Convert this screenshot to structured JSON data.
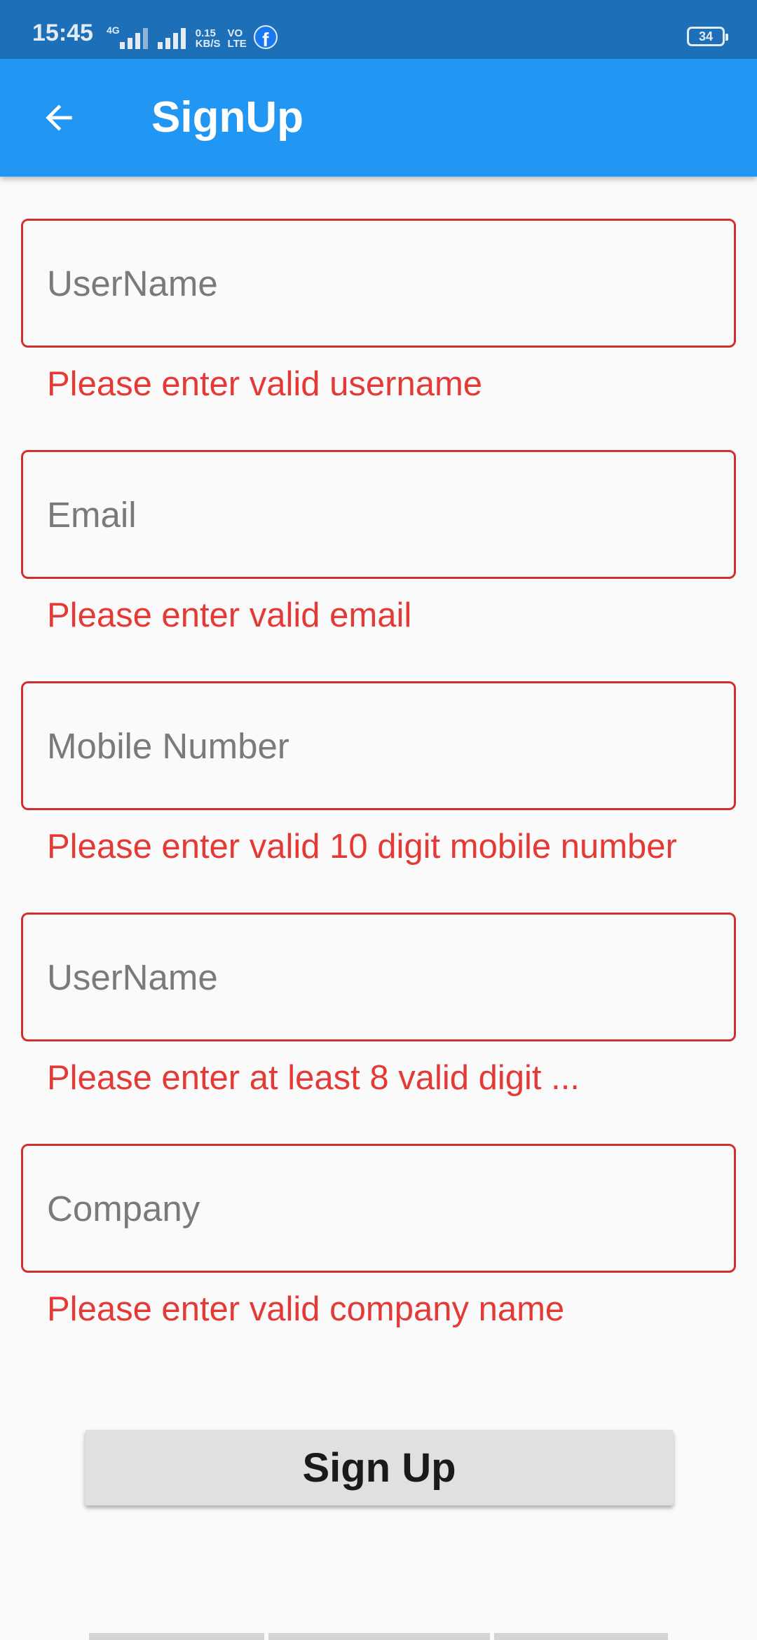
{
  "status_bar": {
    "time": "15:45",
    "network_label": "4G",
    "speed_value": "0.15",
    "speed_unit": "KB/S",
    "volte_top": "VO",
    "volte_bottom": "LTE",
    "notification_icon": "facebook-icon",
    "battery_level": "34"
  },
  "app_bar": {
    "back_icon": "arrow-left-icon",
    "title": "SignUp",
    "background_color": "#2196f3"
  },
  "form": {
    "fields": [
      {
        "placeholder": "UserName",
        "value": "",
        "error": "Please enter valid username"
      },
      {
        "placeholder": "Email",
        "value": "",
        "error": "Please enter valid email"
      },
      {
        "placeholder": "Mobile Number",
        "value": "",
        "error": "Please enter valid 10 digit mobile number"
      },
      {
        "placeholder": "UserName",
        "value": "",
        "error": "Please enter at least 8 valid digit ..."
      },
      {
        "placeholder": "Company",
        "value": "",
        "error": "Please enter valid company name"
      }
    ],
    "error_color": "#e53935",
    "submit_label": "Sign Up"
  }
}
